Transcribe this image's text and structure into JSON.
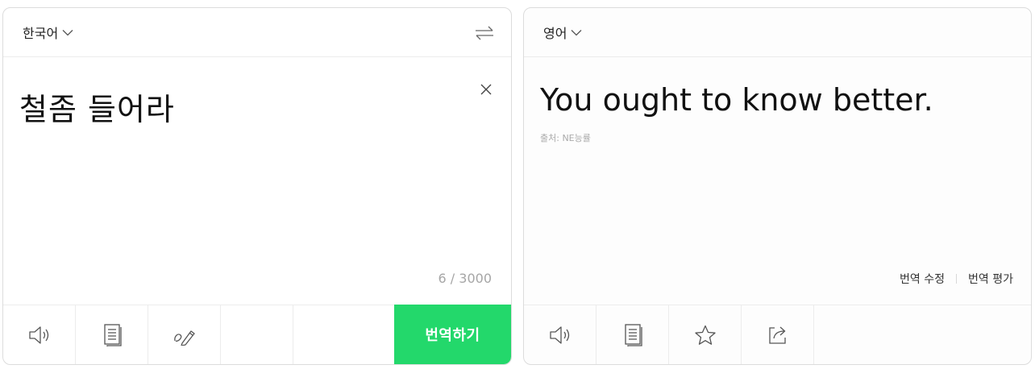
{
  "source": {
    "language": "한국어",
    "text": "철좀 들어라",
    "char_count": "6 / 3000",
    "translate_button": "번역하기",
    "icons": [
      "speaker-icon",
      "document-icon",
      "handwriting-icon"
    ]
  },
  "target": {
    "language": "영어",
    "result": "You ought to know better.",
    "credit": "출처: NE능률",
    "edit_link": "번역 수정",
    "rate_link": "번역 평가",
    "icons": [
      "speaker-icon",
      "document-icon",
      "star-icon",
      "share-icon"
    ]
  },
  "colors": {
    "accent": "#23d86b",
    "border": "#dcdcdc",
    "muted_text": "#a6a6a6"
  }
}
